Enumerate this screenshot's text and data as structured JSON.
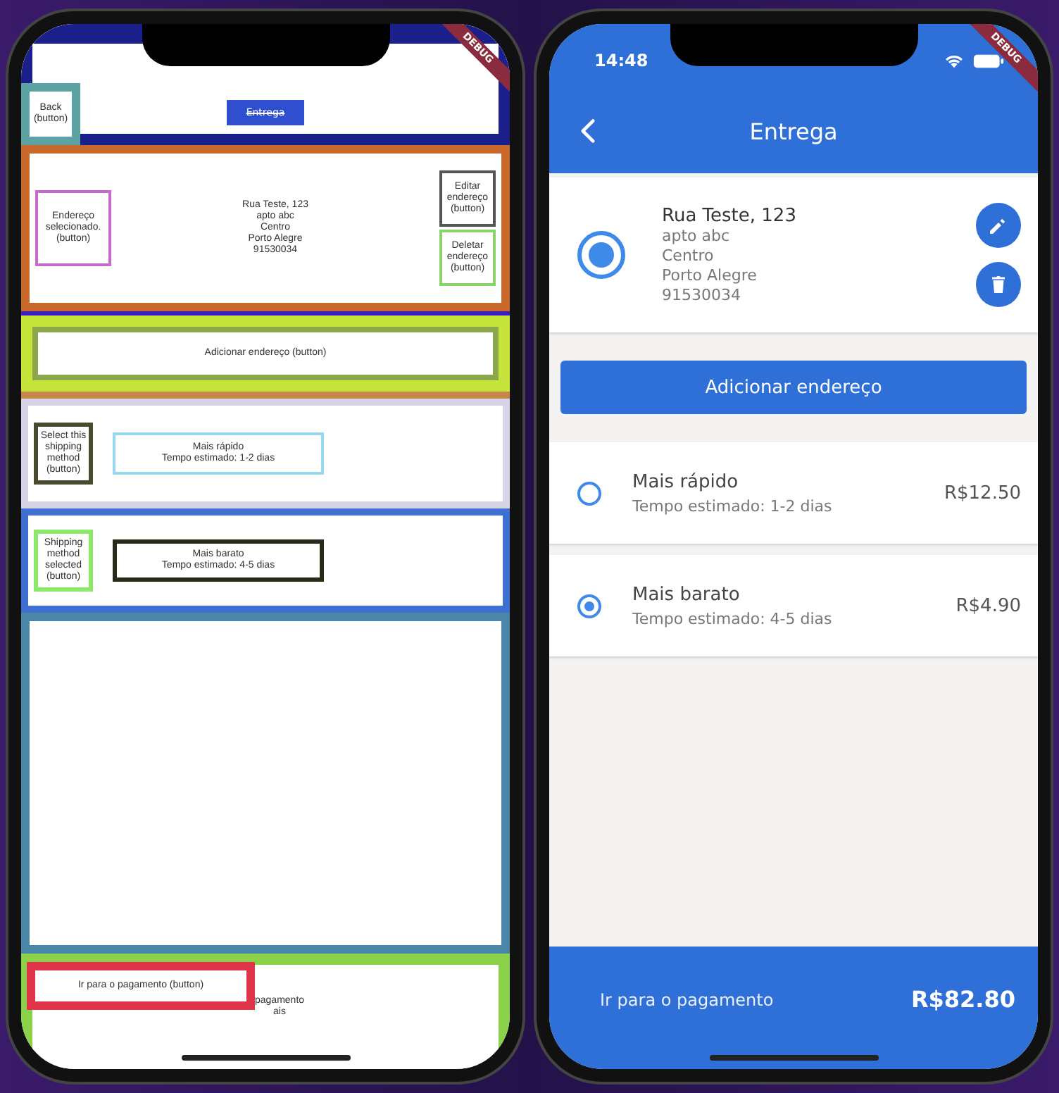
{
  "semantics_view": {
    "debug_banner": "DEBUG",
    "back": "Back (button)",
    "title": "Entrega",
    "address_select": "Endereço selecionado. (button)",
    "address_lines": [
      "Rua Teste, 123",
      "apto abc",
      "Centro",
      "Porto Alegre",
      "91530034"
    ],
    "edit": "Editar endereço (button)",
    "delete": "Deletar endereço (button)",
    "add": "Adicionar endereço (button)",
    "options": [
      {
        "control": "Select this shipping method (button)",
        "lines": [
          "Mais rápido",
          "Tempo estimado: 1-2 dias"
        ]
      },
      {
        "control": "Shipping method selected (button)",
        "lines": [
          "Mais barato",
          "Tempo estimado: 4-5 dias"
        ]
      }
    ],
    "checkout": "Ir para o pagamento (button)",
    "checkout_hidden": [
      "pagamento",
      "ais"
    ]
  },
  "app_view": {
    "time": "14:48",
    "debug_banner": "DEBUG",
    "title": "Entrega",
    "address": {
      "selected": true,
      "lines": [
        "Rua Teste, 123",
        "apto abc",
        "Centro",
        "Porto Alegre",
        "91530034"
      ]
    },
    "add_button": "Adicionar endereço",
    "shipping_options": [
      {
        "name": "Mais rápido",
        "estimate": "Tempo estimado: 1-2 dias",
        "price": "R$12.50",
        "selected": false
      },
      {
        "name": "Mais barato",
        "estimate": "Tempo estimado: 4-5 dias",
        "price": "R$4.90",
        "selected": true
      }
    ],
    "checkout": {
      "label": "Ir para o pagamento",
      "total": "R$82.80"
    }
  }
}
